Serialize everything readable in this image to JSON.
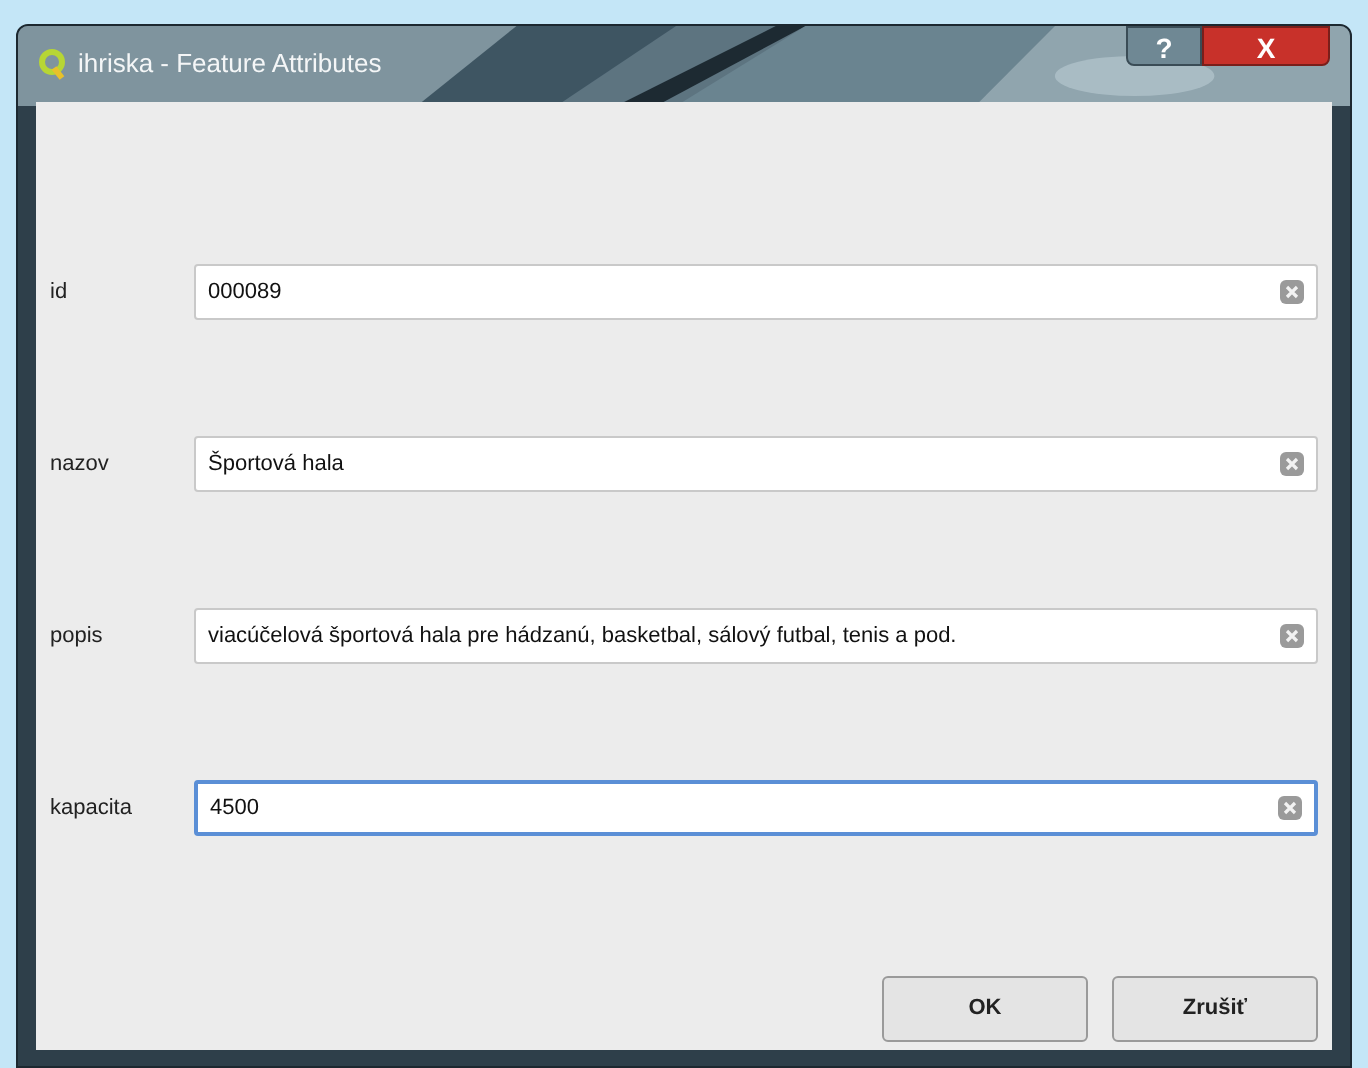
{
  "window": {
    "title": "ihriska - Feature Attributes",
    "help_button": "?",
    "close_button": "X"
  },
  "fields": [
    {
      "label": "id",
      "value": "000089",
      "focused": false
    },
    {
      "label": "nazov",
      "value": "Športová hala",
      "focused": false
    },
    {
      "label": "popis",
      "value": "viacúčelová športová hala pre hádzanú, basketbal, sálový futbal, tenis a pod.",
      "focused": false
    },
    {
      "label": "kapacita",
      "value": "4500",
      "focused": true
    }
  ],
  "buttons": [
    "OK",
    "Zrušiť"
  ]
}
